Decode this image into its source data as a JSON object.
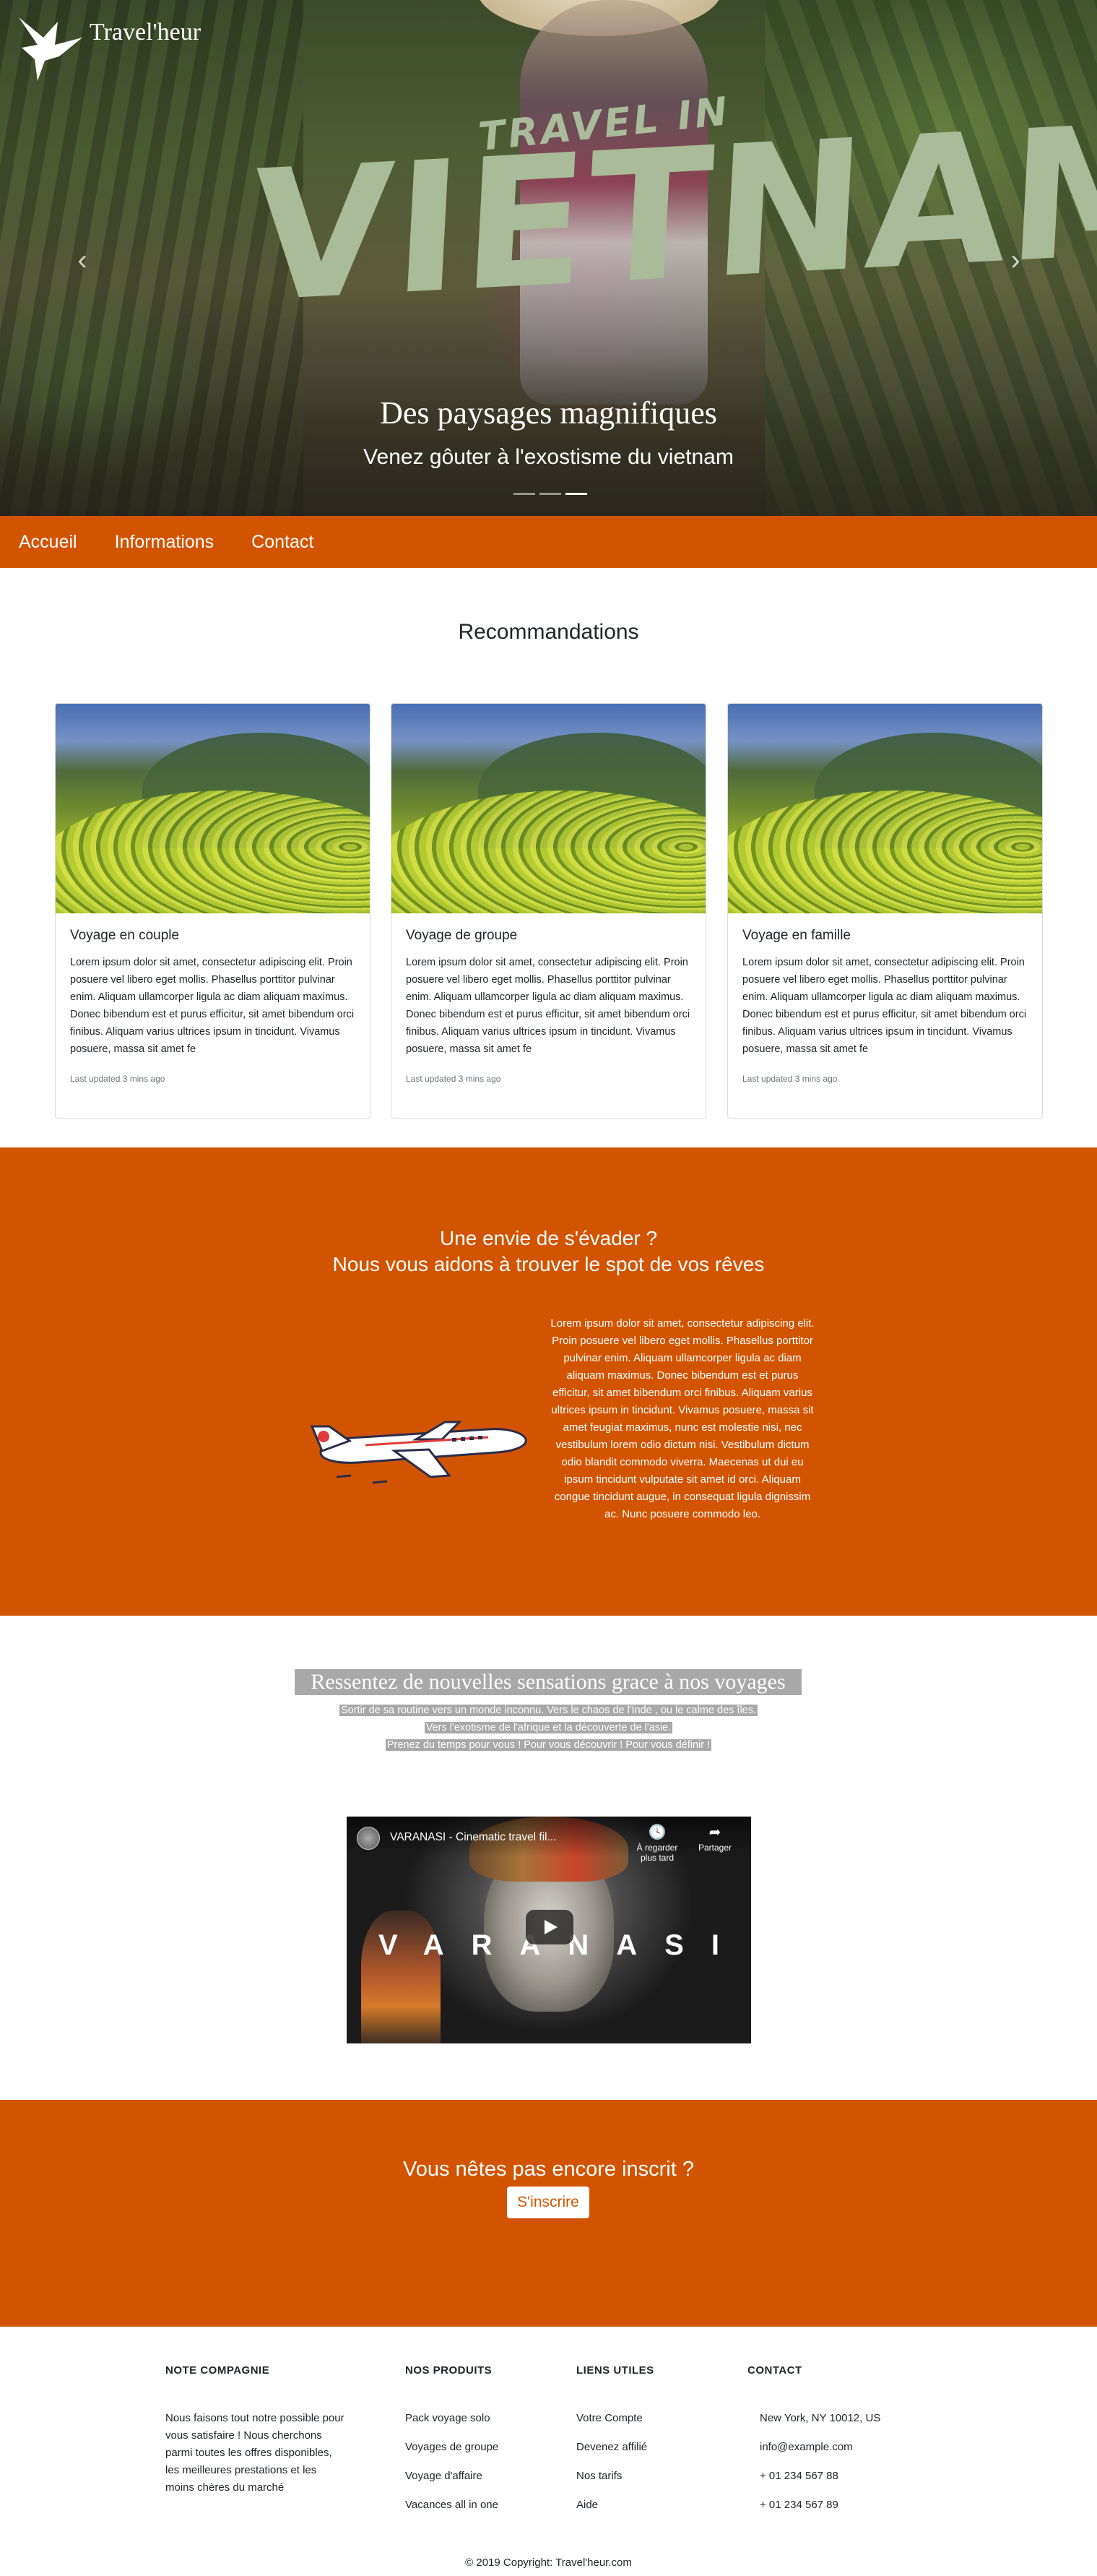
{
  "brand": {
    "name": "Travel'heur"
  },
  "hero": {
    "overlay_small": "TRAVEL IN",
    "overlay_big": "VIETNAM",
    "caption_title": "Des paysages magnifiques",
    "caption_subtitle": "Venez gôuter à l'exostisme du vietnam",
    "prev_arrow": "‹",
    "next_arrow": "›",
    "slides_count": 3,
    "active_slide": 3
  },
  "nav": {
    "items": [
      {
        "label": "Accueil"
      },
      {
        "label": "Informations"
      },
      {
        "label": "Contact"
      }
    ]
  },
  "recommandations": {
    "title": "Recommandations",
    "cards": [
      {
        "title": "Voyage en couple",
        "text": "Lorem ipsum dolor sit amet, consectetur adipiscing elit. Proin posuere vel libero eget mollis. Phasellus porttitor pulvinar enim. Aliquam ullamcorper ligula ac diam aliquam maximus. Donec bibendum est et purus efficitur, sit amet bibendum orci finibus. Aliquam varius ultrices ipsum in tincidunt. Vivamus posuere, massa sit amet fe",
        "updated": "Last updated 3 mins ago"
      },
      {
        "title": "Voyage de groupe",
        "text": "Lorem ipsum dolor sit amet, consectetur adipiscing elit. Proin posuere vel libero eget mollis. Phasellus porttitor pulvinar enim. Aliquam ullamcorper ligula ac diam aliquam maximus. Donec bibendum est et purus efficitur, sit amet bibendum orci finibus. Aliquam varius ultrices ipsum in tincidunt. Vivamus posuere, massa sit amet fe",
        "updated": "Last updated 3 mins ago"
      },
      {
        "title": "Voyage en famille",
        "text": "Lorem ipsum dolor sit amet, consectetur adipiscing elit. Proin posuere vel libero eget mollis. Phasellus porttitor pulvinar enim. Aliquam ullamcorper ligula ac diam aliquam maximus. Donec bibendum est et purus efficitur, sit amet bibendum orci finibus. Aliquam varius ultrices ipsum in tincidunt. Vivamus posuere, massa sit amet fe",
        "updated": "Last updated 3 mins ago"
      }
    ]
  },
  "escape": {
    "line1": "Une envie de s'évader ?",
    "line2": "Nous vous aidons à trouver le spot de vos rêves",
    "text": "Lorem ipsum dolor sit amet, consectetur adipiscing elit. Proin posuere vel libero eget mollis. Phasellus porttitor pulvinar enim. Aliquam ullamcorper ligula ac diam aliquam maximus. Donec bibendum est et purus efficitur, sit amet bibendum orci finibus. Aliquam varius ultrices ipsum in tincidunt. Vivamus posuere, massa sit amet feugiat maximus, nunc est molestie nisi, nec vestibulum lorem odio dictum nisi. Vestibulum dictum odio blandit commodo viverra. Maecenas ut dui eu ipsum tincidunt vulputate sit amet id orci. Aliquam congue tincidunt augue, in consequat ligula dignissim ac. Nunc posuere commodo leo."
  },
  "sensations": {
    "title": "Ressentez de nouvelles sensations grace à nos voyages",
    "lines": [
      "Sortir de sa routine vers un monde inconnu. Vers le chaos de l'Inde , ou le calme des îles.",
      "Vers l'exotisme de l'afrique et la découverte de l'asie.",
      "Prenez du temps pour vous ! Pour vous découvrir ! Pour vous définir !"
    ]
  },
  "video": {
    "title": "VARANASI - Cinematic travel fil...",
    "watch_later": "À regarder plus tard",
    "share": "Partager",
    "overlay_word": "VARANASI"
  },
  "signup": {
    "question": "Vous nêtes pas encore inscrit ?",
    "button": "S'inscrire"
  },
  "footer": {
    "columns": {
      "company": {
        "title": "NOTE COMPAGNIE",
        "text": "Nous faisons tout notre possible pour vous satisfaire ! Nous cherchons parmi toutes les offres disponibles, les meilleures prestations et les moins chères du marché"
      },
      "products": {
        "title": "NOS PRODUITS",
        "items": [
          "Pack voyage solo",
          "Voyages de groupe",
          "Voyage d'affaire",
          "Vacances all in one"
        ]
      },
      "links": {
        "title": "LIENS UTILES",
        "items": [
          "Votre Compte",
          "Devenez affilié",
          "Nos tarifs",
          "Aide"
        ]
      },
      "contact": {
        "title": "CONTACT",
        "items": [
          "New York, NY 10012, US",
          "info@example.com",
          "+ 01 234 567 88",
          "+ 01 234 567 89"
        ]
      }
    },
    "copyright": "© 2019 Copyright: Travel'heur.com"
  },
  "colors": {
    "accent": "#d35400",
    "overlay_text": "#a9bb98",
    "highlight_bg": "#a8a8a8"
  },
  "icons": {
    "logo": "bird-logo-icon",
    "watch_later": "clock-icon",
    "share": "share-arrow-icon",
    "play": "play-icon"
  }
}
